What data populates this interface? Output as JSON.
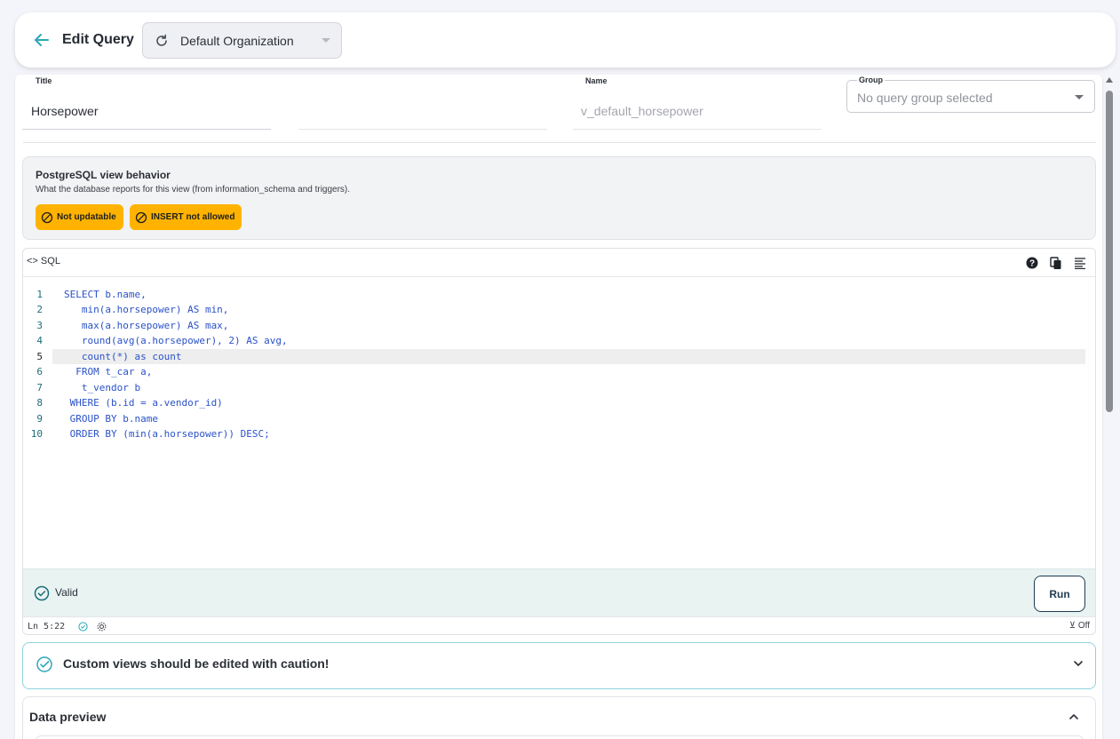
{
  "header": {
    "title": "Edit Query",
    "organization": "Default Organization"
  },
  "form": {
    "title_label": "Title",
    "title_value": "Horsepower",
    "name_label": "Name",
    "name_value": "v_default_horsepower",
    "group_label": "Group",
    "group_placeholder": "No query group selected"
  },
  "pg_behavior": {
    "title": "PostgreSQL view behavior",
    "description": "What the database reports for this view (from information_schema and triggers).",
    "badges": [
      "Not updatable",
      "INSERT not allowed"
    ],
    "badge_color": "#ffb300"
  },
  "editor": {
    "tab_label": "SQL",
    "icons": [
      "help-icon",
      "copy-icon",
      "format-icon"
    ],
    "lines": [
      "SELECT b.name,",
      "   min(a.horsepower) AS min,",
      "   max(a.horsepower) AS max,",
      "   round(avg(a.horsepower), 2) AS avg,",
      "   count(*) as count",
      "  FROM t_car a,",
      "   t_vendor b",
      " WHERE (b.id = a.vendor_id)",
      " GROUP BY b.name",
      " ORDER BY (min(a.horsepower)) DESC;"
    ],
    "line_numbers": [
      "1",
      "2",
      "3",
      "4",
      "5",
      "6",
      "7",
      "8",
      "9",
      "10"
    ],
    "active_line": 5,
    "validation": "Valid",
    "run_label": "Run",
    "cursor_position": "Ln 5:22",
    "wrap_state": "Off"
  },
  "caution": {
    "text": "Custom views should be edited with caution!"
  },
  "preview": {
    "title": "Data preview"
  },
  "colors": {
    "accent": "#2aa7b8",
    "code_blue": "#2a52c8",
    "line_number": "#1d6d7a"
  }
}
